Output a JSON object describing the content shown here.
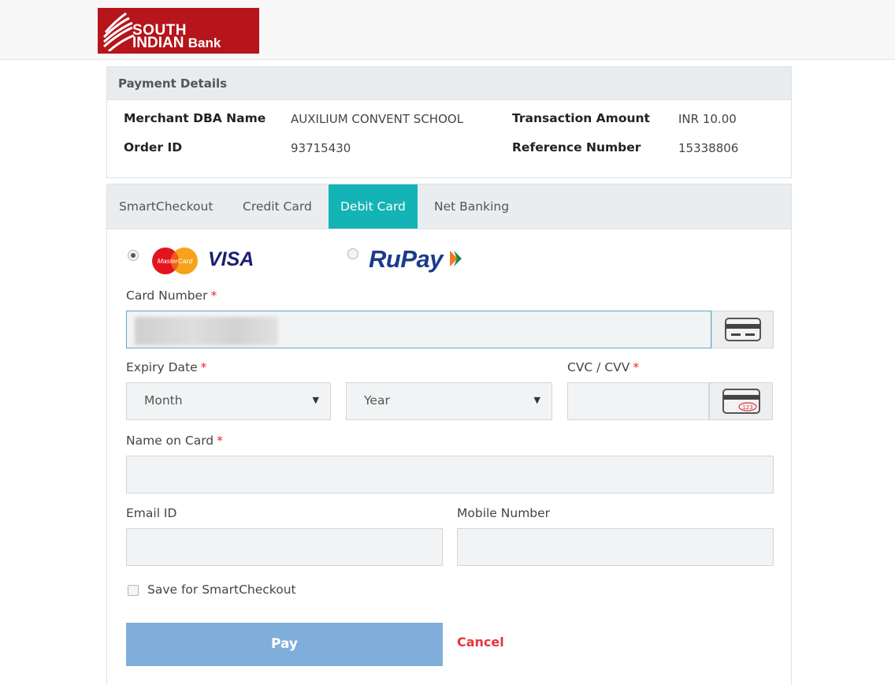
{
  "brand": {
    "logo_line1": "SOUTH",
    "logo_line2": "INDIAN",
    "logo_line3": "Bank",
    "color": "#b5151b"
  },
  "payment_details": {
    "title": "Payment Details",
    "merchant_label": "Merchant DBA Name",
    "merchant_value": "AUXILIUM CONVENT SCHOOL",
    "amount_label": "Transaction Amount",
    "amount_value": "INR 10.00",
    "order_label": "Order ID",
    "order_value": "93715430",
    "reference_label": "Reference Number",
    "reference_value": "15338806"
  },
  "tabs": [
    {
      "label": "SmartCheckout",
      "active": false
    },
    {
      "label": "Credit Card",
      "active": false
    },
    {
      "label": "Debit Card",
      "active": true
    },
    {
      "label": "Net Banking",
      "active": false
    }
  ],
  "card_types": {
    "mastercard_label": "MasterCard",
    "visa_label": "VISA",
    "rupay_label": "RuPay",
    "selected": "mastercard-visa"
  },
  "form": {
    "card_number_label": "Card Number",
    "required_mark": "*",
    "expiry_label": "Expiry Date",
    "month_value": "Month",
    "year_value": "Year",
    "cvv_label": "CVC / CVV",
    "cvv_icon_text": "123",
    "name_label": "Name on Card",
    "email_label": "Email ID",
    "mobile_label": "Mobile Number",
    "save_label": "Save for SmartCheckout",
    "pay_label": "Pay",
    "cancel_label": "Cancel"
  },
  "colors": {
    "accent": "#14b3b5",
    "pay_button": "#7faedb",
    "cancel": "#e4363b",
    "required": "#ee2233"
  }
}
